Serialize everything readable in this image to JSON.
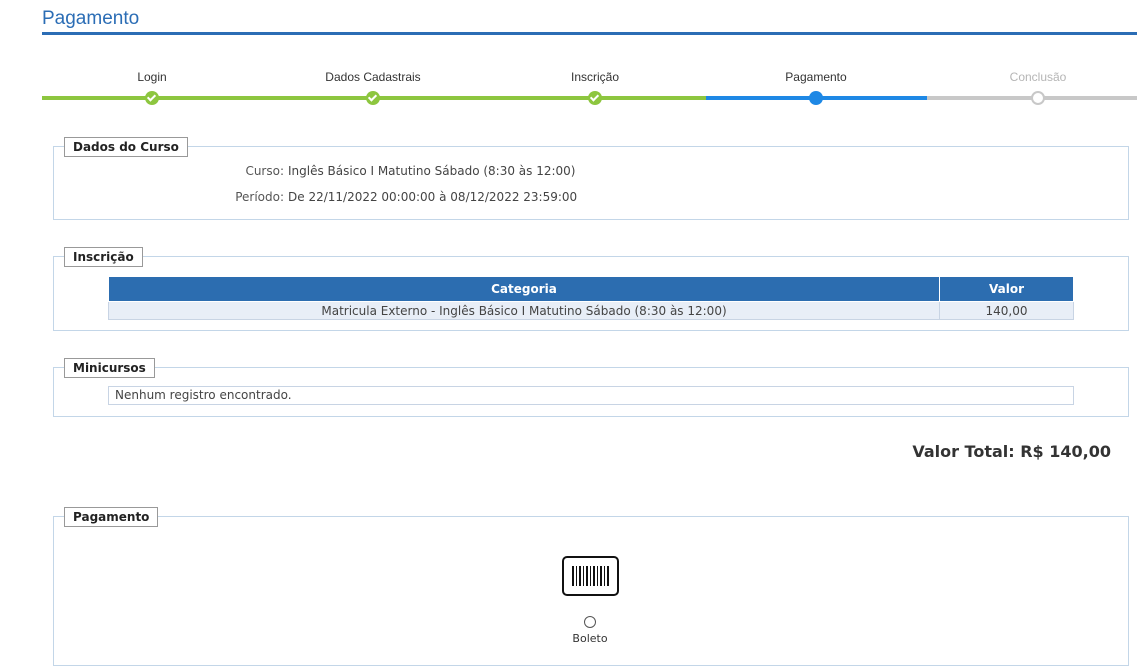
{
  "page": {
    "title": "Pagamento"
  },
  "stepper": {
    "steps": [
      {
        "label": "Login",
        "state": "done"
      },
      {
        "label": "Dados Cadastrais",
        "state": "done"
      },
      {
        "label": "Inscrição",
        "state": "done"
      },
      {
        "label": "Pagamento",
        "state": "current"
      },
      {
        "label": "Conclusão",
        "state": "future"
      }
    ],
    "colors": {
      "done": "#8dc63f",
      "current": "#1e88e5",
      "future": "#c8c8c8"
    }
  },
  "dados_curso": {
    "legend": "Dados do Curso",
    "curso_label": "Curso:",
    "curso_value": "Inglês Básico I Matutino Sábado (8:30 às 12:00)",
    "periodo_label": "Período:",
    "periodo_value": "De 22/11/2022 00:00:00 à 08/12/2022 23:59:00"
  },
  "inscricao": {
    "legend": "Inscrição",
    "columns": [
      "Categoria",
      "Valor"
    ],
    "rows": [
      {
        "categoria": "Matricula Externo - Inglês Básico I Matutino Sábado (8:30 às 12:00)",
        "valor": "140,00"
      }
    ]
  },
  "minicursos": {
    "legend": "Minicursos",
    "empty_text": "Nenhum registro encontrado."
  },
  "total": {
    "text": "Valor Total: R$ 140,00"
  },
  "pagamento": {
    "legend": "Pagamento",
    "option_label": "Boleto",
    "option_icon": "barcode-icon"
  }
}
